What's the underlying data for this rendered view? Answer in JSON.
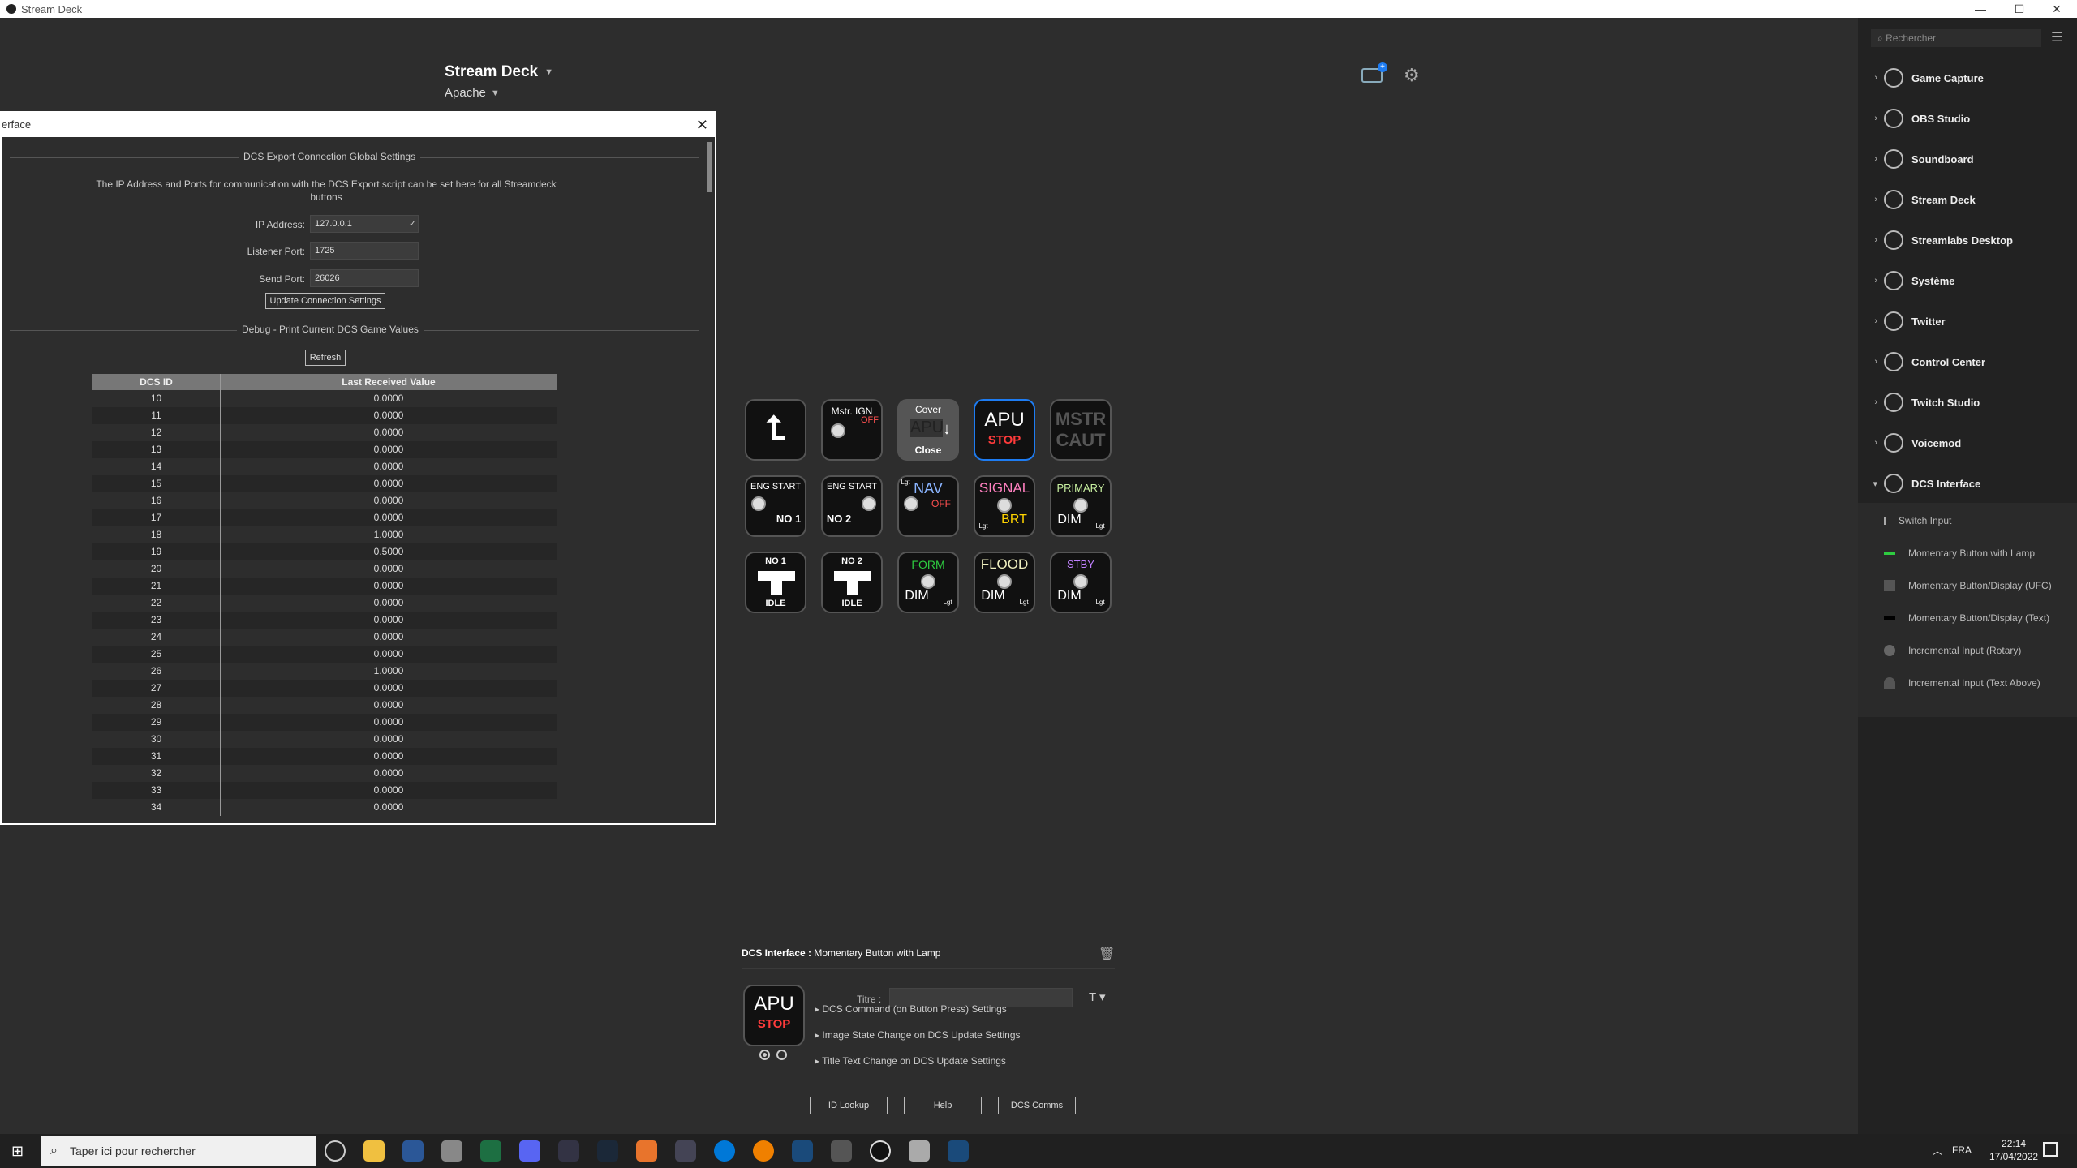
{
  "window": {
    "title": "Stream Deck",
    "minimize": "—",
    "maximize": "☐",
    "close": "✕"
  },
  "header": {
    "app_title": "Stream Deck",
    "profile": "Apache"
  },
  "keys": [
    {
      "lines": [
        "⮤"
      ]
    },
    {
      "lines": [
        "Mstr. IGN",
        "OFF"
      ]
    },
    {
      "lines": [
        "Cover",
        "APU",
        "Close"
      ]
    },
    {
      "lines": [
        "APU",
        "STOP"
      ]
    },
    {
      "lines": [
        "MSTR",
        "CAUT"
      ]
    },
    {
      "lines": [
        "ENG START",
        "NO 1"
      ]
    },
    {
      "lines": [
        "ENG START",
        "NO 2"
      ]
    },
    {
      "lines": [
        "NAV",
        "OFF",
        "Lgt"
      ]
    },
    {
      "lines": [
        "SIGNAL",
        "BRT",
        "Lgt"
      ]
    },
    {
      "lines": [
        "PRIMARY",
        "DIM",
        "Lgt"
      ]
    },
    {
      "lines": [
        "NO 1",
        "IDLE"
      ]
    },
    {
      "lines": [
        "NO 2",
        "IDLE"
      ]
    },
    {
      "lines": [
        "FORM",
        "DIM",
        "Lgt"
      ]
    },
    {
      "lines": [
        "FLOOD",
        "DIM",
        "Lgt"
      ]
    },
    {
      "lines": [
        "STBY",
        "DIM",
        "Lgt"
      ]
    }
  ],
  "inspector": {
    "plugin": "DCS Interface :",
    "action": "Momentary Button with Lamp",
    "preview_line1": "APU",
    "preview_line2": "STOP",
    "titre_label": "Titre :",
    "titre_value": "",
    "sections": [
      "DCS Command (on Button Press) Settings",
      "Image State Change on DCS Update Settings",
      "Title Text Change on DCS Update Settings"
    ],
    "buttons": [
      "ID Lookup",
      "Help",
      "DCS Comms"
    ]
  },
  "dialog": {
    "title": "erface",
    "section1": "DCS Export Connection Global Settings",
    "description": "The IP Address and Ports for communication with the DCS Export script can be set here for all Streamdeck buttons",
    "ip_label": "IP Address:",
    "ip_value": "127.0.0.1",
    "listener_label": "Listener Port:",
    "listener_value": "1725",
    "send_label": "Send Port:",
    "send_value": "26026",
    "update_button": "Update Connection Settings",
    "section2": "Debug - Print Current DCS Game Values",
    "refresh_button": "Refresh",
    "table": {
      "headers": [
        "DCS ID",
        "Last Received Value"
      ],
      "rows": [
        [
          "10",
          "0.0000"
        ],
        [
          "11",
          "0.0000"
        ],
        [
          "12",
          "0.0000"
        ],
        [
          "13",
          "0.0000"
        ],
        [
          "14",
          "0.0000"
        ],
        [
          "15",
          "0.0000"
        ],
        [
          "16",
          "0.0000"
        ],
        [
          "17",
          "0.0000"
        ],
        [
          "18",
          "1.0000"
        ],
        [
          "19",
          "0.5000"
        ],
        [
          "20",
          "0.0000"
        ],
        [
          "21",
          "0.0000"
        ],
        [
          "22",
          "0.0000"
        ],
        [
          "23",
          "0.0000"
        ],
        [
          "24",
          "0.0000"
        ],
        [
          "25",
          "0.0000"
        ],
        [
          "26",
          "1.0000"
        ],
        [
          "27",
          "0.0000"
        ],
        [
          "28",
          "0.0000"
        ],
        [
          "29",
          "0.0000"
        ],
        [
          "30",
          "0.0000"
        ],
        [
          "31",
          "0.0000"
        ],
        [
          "32",
          "0.0000"
        ],
        [
          "33",
          "0.0000"
        ],
        [
          "34",
          "0.0000"
        ]
      ]
    }
  },
  "sidebar": {
    "search_placeholder": "Rechercher",
    "categories": [
      "Game Capture",
      "OBS Studio",
      "Soundboard",
      "Stream Deck",
      "Streamlabs Desktop",
      "Système",
      "Twitter",
      "Control Center",
      "Twitch Studio",
      "Voicemod",
      "DCS Interface"
    ],
    "actions": [
      "Switch Input",
      "Momentary Button with Lamp",
      "Momentary Button/Display (UFC)",
      "Momentary Button/Display (Text)",
      "Incremental Input (Rotary)",
      "Incremental Input (Text Above)"
    ]
  },
  "taskbar": {
    "search_placeholder": "Taper ici pour rechercher",
    "language": "FRA",
    "time": "22:14",
    "date": "17/04/2022"
  },
  "colors": {
    "accent": "#1e7cf2",
    "apu_stop": "#ff3b3b",
    "mstr_caut": "#555555",
    "form_green": "#2ecc40",
    "stby_purple": "#c080ff",
    "signal_pink": "#ff80c0",
    "brt_yellow": "#ffd400"
  }
}
